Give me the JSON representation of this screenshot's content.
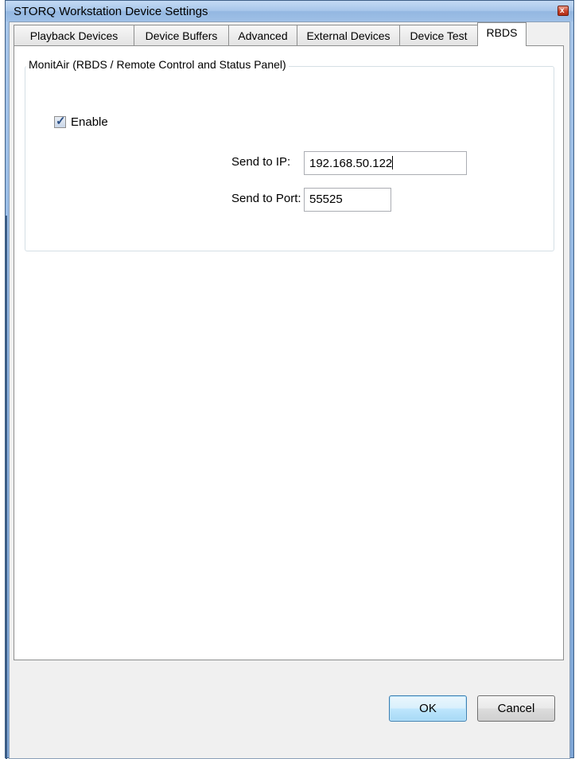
{
  "window": {
    "title": "STORQ Workstation Device Settings",
    "close_label": "x"
  },
  "tabs": [
    {
      "label": "Playback Devices",
      "active": false
    },
    {
      "label": "Device Buffers",
      "active": false
    },
    {
      "label": "Advanced",
      "active": false
    },
    {
      "label": "External Devices",
      "active": false
    },
    {
      "label": "Device Test",
      "active": false
    },
    {
      "label": "RBDS",
      "active": true
    }
  ],
  "rbds": {
    "group_title": "MonitAir (RBDS / Remote Control and Status Panel)",
    "enable_label": "Enable",
    "enable_checked": true,
    "send_ip_label": "Send to IP:",
    "send_ip_value": "192.168.50.122",
    "send_port_label": "Send to Port:",
    "send_port_value": "55525"
  },
  "buttons": {
    "ok": "OK",
    "cancel": "Cancel"
  },
  "colors": {
    "frame": "#8db4e2",
    "default_button": "#bee6fd",
    "checkbox_mark": "#2b4f86"
  },
  "icons": {
    "close": "close-icon",
    "check": "checkmark-icon"
  }
}
